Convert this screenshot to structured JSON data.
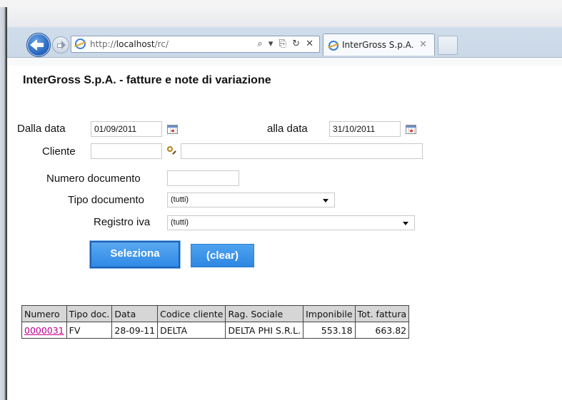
{
  "browser": {
    "url_prefix": "http://",
    "url_host": "localhost",
    "url_path": "/rc/",
    "address_controls": "⌕ ▾ ⎘ ↻ ✕",
    "tab_title": "InterGross S.p.A.",
    "tab_close": "✕"
  },
  "page": {
    "title": "InterGross S.p.A. - fatture e note di variazione"
  },
  "form": {
    "dalla_data_label": "Dalla data",
    "dalla_data_value": "01/09/2011",
    "alla_data_label": "alla data",
    "alla_data_value": "31/10/2011",
    "cliente_label": "Cliente",
    "cliente_code_value": "",
    "cliente_name_value": "",
    "numero_documento_label": "Numero documento",
    "numero_documento_value": "",
    "tipo_documento_label": "Tipo documento",
    "tipo_documento_selected": "(tutti)",
    "registro_iva_label": "Registro iva",
    "registro_iva_selected": "(tutti)",
    "seleziona_label": "Seleziona",
    "clear_label": "(clear)"
  },
  "results": {
    "columns": [
      "Numero",
      "Tipo doc.",
      "Data",
      "Codice cliente",
      "Rag. Sociale",
      "Imponibile",
      "Tot. fattura"
    ],
    "rows": [
      {
        "numero": "0000031",
        "tipo_doc": "FV",
        "data": "28-09-11",
        "codice_cliente": "DELTA",
        "rag_sociale": "DELTA PHI S.R.L.",
        "imponibile": "553.18",
        "tot_fattura": "663.82"
      }
    ]
  },
  "colors": {
    "button_blue": "#2f8ae6",
    "link_magenta": "#c0008c",
    "header_gray": "#d6d6d6"
  }
}
